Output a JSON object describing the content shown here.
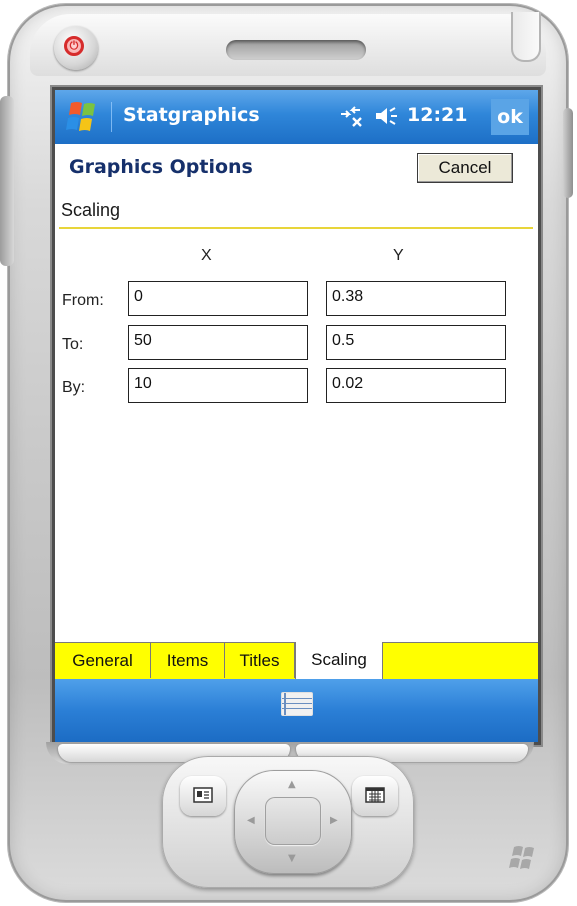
{
  "status_bar": {
    "app_name": "Statgraphics",
    "time": "12:21",
    "ok_label": "ok"
  },
  "header": {
    "title": "Graphics Options",
    "cancel_label": "Cancel"
  },
  "section": {
    "label": "Scaling"
  },
  "scaling": {
    "col_x": "X",
    "col_y": "Y",
    "rows": [
      {
        "label": "From:",
        "x": "0",
        "y": "0.38"
      },
      {
        "label": "To:",
        "x": "50",
        "y": "0.5"
      },
      {
        "label": "By:",
        "x": "10",
        "y": "0.02"
      }
    ]
  },
  "tabs": [
    {
      "label": "General",
      "active": false
    },
    {
      "label": "Items",
      "active": false
    },
    {
      "label": "Titles",
      "active": false
    },
    {
      "label": "Scaling",
      "active": true
    }
  ],
  "icons": {
    "start": "windows-flag-icon",
    "connectivity": "connectivity-icon",
    "volume": "speaker-icon",
    "keyboard": "keyboard-icon",
    "power": "power-icon",
    "left_hw": "contacts-icon",
    "right_hw": "calendar-icon"
  },
  "colors": {
    "titlebar_blue": "#2f86d9",
    "header_text": "#16306b",
    "tab_yellow": "#ffff00",
    "rule_yellow": "#e8d53a"
  }
}
